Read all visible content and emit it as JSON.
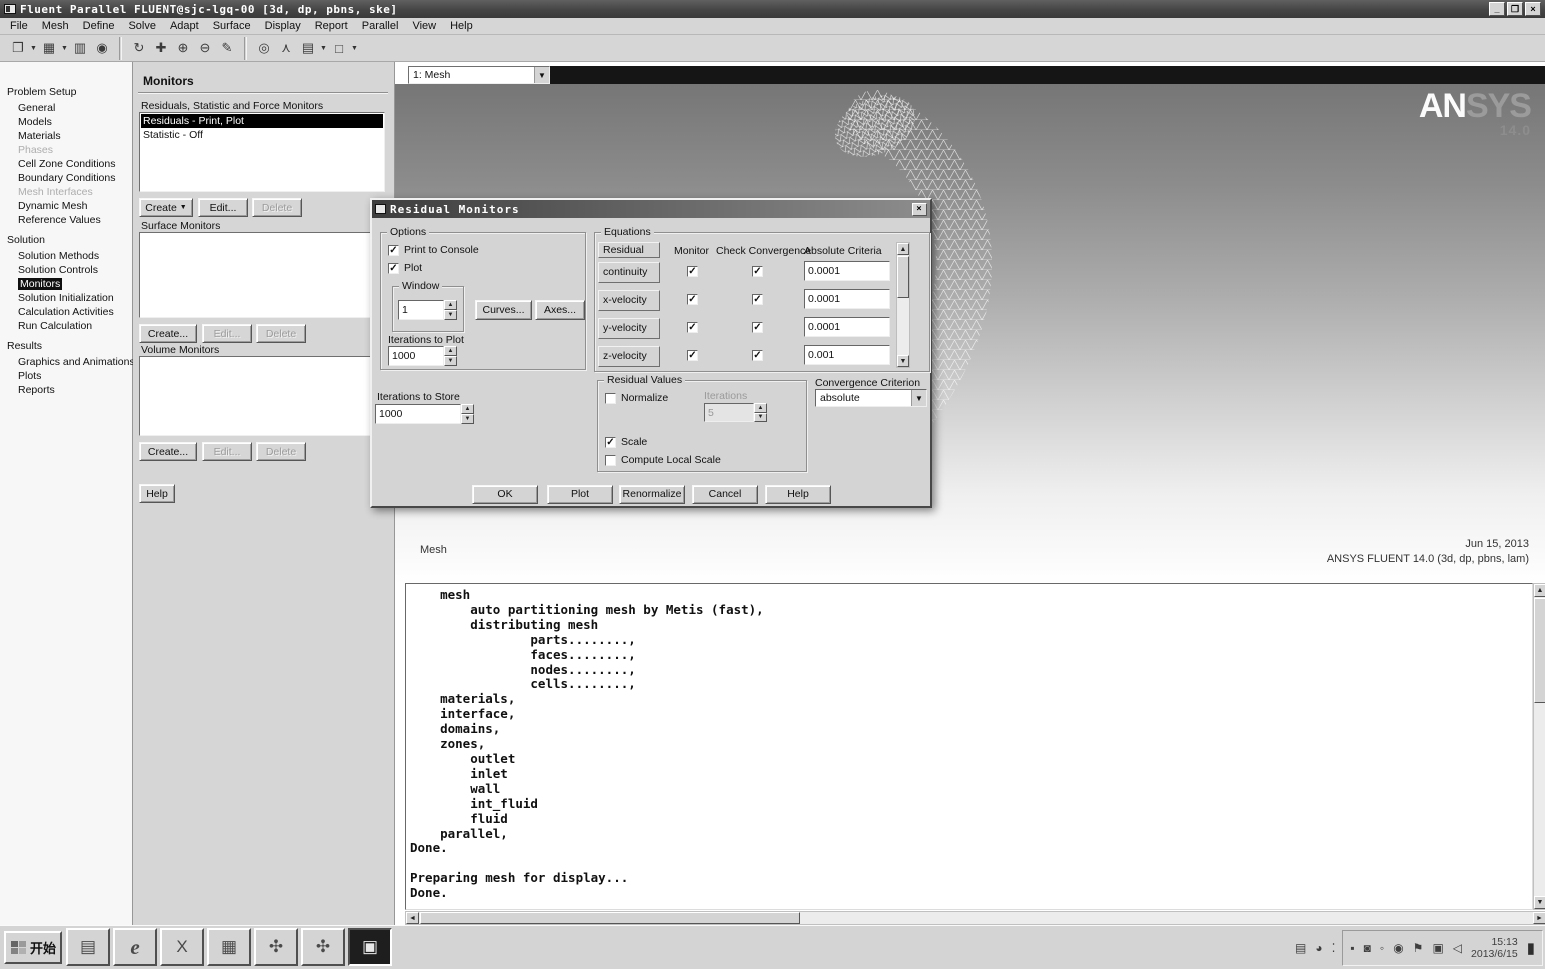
{
  "icons": {
    "dropdown": "▼",
    "up": "▲",
    "down": "▼",
    "left": "◄",
    "right": "►"
  },
  "window": {
    "title": "Fluent Parallel FLUENT@sjc-lgq-00  [3d, dp, pbns, ske]",
    "minimize": "_",
    "restore": "❐",
    "close": "×"
  },
  "menubar": {
    "items": [
      "File",
      "Mesh",
      "Define",
      "Solve",
      "Adapt",
      "Surface",
      "Display",
      "Report",
      "Parallel",
      "View",
      "Help"
    ]
  },
  "toolbar": {
    "buttons": [
      {
        "name": "open-file",
        "glyph": "❐"
      },
      {
        "name": "save-file",
        "glyph": "▦"
      },
      {
        "name": "write-file",
        "glyph": "▥"
      },
      {
        "name": "refresh",
        "glyph": "◉"
      },
      {
        "name": "rotate-view",
        "glyph": "↻"
      },
      {
        "name": "pan-view",
        "glyph": "✚"
      },
      {
        "name": "zoom-in",
        "glyph": "⊕"
      },
      {
        "name": "zoom-out",
        "glyph": "⊖"
      },
      {
        "name": "probe",
        "glyph": "✎"
      },
      {
        "name": "magnify",
        "glyph": "◎"
      },
      {
        "name": "orient",
        "glyph": "⋏"
      },
      {
        "name": "grid-display",
        "glyph": "▤"
      },
      {
        "name": "box-display",
        "glyph": "□"
      }
    ]
  },
  "sidebar": {
    "sections": [
      {
        "title": "Problem Setup",
        "items": [
          {
            "label": "General"
          },
          {
            "label": "Models"
          },
          {
            "label": "Materials"
          },
          {
            "label": "Phases",
            "state": "disabled"
          },
          {
            "label": "Cell Zone Conditions"
          },
          {
            "label": "Boundary Conditions"
          },
          {
            "label": "Mesh Interfaces",
            "state": "disabled"
          },
          {
            "label": "Dynamic Mesh"
          },
          {
            "label": "Reference Values"
          }
        ]
      },
      {
        "title": "Solution",
        "items": [
          {
            "label": "Solution Methods"
          },
          {
            "label": "Solution Controls"
          },
          {
            "label": "Monitors",
            "state": "selected"
          },
          {
            "label": "Solution Initialization"
          },
          {
            "label": "Calculation Activities"
          },
          {
            "label": "Run Calculation"
          }
        ]
      },
      {
        "title": "Results",
        "items": [
          {
            "label": "Graphics and Animations"
          },
          {
            "label": "Plots"
          },
          {
            "label": "Reports"
          }
        ]
      }
    ]
  },
  "monitors": {
    "title": "Monitors",
    "residuals_label": "Residuals, Statistic and Force Monitors",
    "residuals_list": [
      {
        "label": "Residuals - Print, Plot",
        "selected": true
      },
      {
        "label": "Statistic - Off",
        "selected": false
      }
    ],
    "residuals_buttons": {
      "create": "Create",
      "edit": "Edit...",
      "delete": "Delete"
    },
    "surface_label": "Surface Monitors",
    "surface_buttons": {
      "create": "Create...",
      "edit": "Edit...",
      "delete": "Delete"
    },
    "volume_label": "Volume Monitors",
    "volume_buttons": {
      "create": "Create...",
      "edit": "Edit...",
      "delete": "Delete"
    },
    "help": "Help"
  },
  "dialog": {
    "title": "Residual Monitors",
    "close": "×",
    "options": {
      "label": "Options",
      "print_to_console": "Print to Console",
      "print_mark": "✓",
      "plot": "Plot",
      "plot_mark": "✓",
      "window_label": "Window",
      "window_value": "1",
      "curves": "Curves...",
      "axes": "Axes...",
      "iterations_to_plot_label": "Iterations to Plot",
      "iterations_to_plot_value": "1000"
    },
    "equations": {
      "label": "Equations",
      "col_residual": "Residual",
      "col_monitor": "Monitor",
      "col_check": "Check Convergence",
      "col_criteria": "Absolute Criteria",
      "rows": [
        {
          "name": "continuity",
          "monitor_mark": "✓",
          "check_mark": "✓",
          "criteria": "0.0001"
        },
        {
          "name": "x-velocity",
          "monitor_mark": "✓",
          "check_mark": "✓",
          "criteria": "0.0001"
        },
        {
          "name": "y-velocity",
          "monitor_mark": "✓",
          "check_mark": "✓",
          "criteria": "0.0001"
        },
        {
          "name": "z-velocity",
          "monitor_mark": "✓",
          "check_mark": "✓",
          "criteria": "0.001"
        }
      ]
    },
    "iterations_to_store": {
      "label": "Iterations to Store",
      "value": "1000"
    },
    "residual_values": {
      "label": "Residual Values",
      "normalize": "Normalize",
      "normalize_mark": "",
      "iterations_label": "Iterations",
      "iterations_value": "5",
      "scale": "Scale",
      "scale_mark": "✓",
      "compute_local_scale": "Compute Local Scale",
      "compute_mark": ""
    },
    "convergence": {
      "label": "Convergence Criterion",
      "value": "absolute"
    },
    "buttons": [
      "OK",
      "Plot",
      "Renormalize",
      "Cancel",
      "Help"
    ]
  },
  "graphics": {
    "view_selector": "1: Mesh",
    "logo_an": "AN",
    "logo_sys": "SYS",
    "logo_version": "14.0",
    "caption": "Mesh",
    "date": "Jun 15, 2013",
    "version_line": "ANSYS FLUENT 14.0 (3d, dp, pbns, lam)",
    "console_text": "    mesh\n        auto partitioning mesh by Metis (fast),\n        distributing mesh\n                parts........,\n                faces........,\n                nodes........,\n                cells........,\n    materials,\n    interface,\n    domains,\n    zones,\n        outlet\n        inlet\n        wall\n        int_fluid\n        fluid\n    parallel,\nDone.\n\nPreparing mesh for display...\nDone."
  },
  "taskbar": {
    "start": "开始",
    "quicklaunch": [
      {
        "name": "show-desktop",
        "glyph": "▤"
      },
      {
        "name": "internet-explorer",
        "glyph": "e"
      },
      {
        "name": "excel",
        "glyph": "X"
      },
      {
        "name": "document-viewer",
        "glyph": "▦"
      },
      {
        "name": "cad-app-1",
        "glyph": "✣"
      },
      {
        "name": "cad-app-2",
        "glyph": "✣"
      },
      {
        "name": "fluent-window",
        "glyph": "▣"
      }
    ],
    "pre_tray": [
      {
        "name": "folder",
        "glyph": "▤"
      },
      {
        "name": "power",
        "glyph": "◕"
      },
      {
        "name": "dots",
        "glyph": "⁚"
      }
    ],
    "tray": [
      {
        "name": "updates",
        "glyph": "▪"
      },
      {
        "name": "security-lock",
        "glyph": "◙"
      },
      {
        "name": "volume-mixer",
        "glyph": "◦"
      },
      {
        "name": "language",
        "glyph": "◉"
      },
      {
        "name": "flag",
        "glyph": "⚑"
      },
      {
        "name": "display",
        "glyph": "▣"
      },
      {
        "name": "speaker",
        "glyph": "◁"
      }
    ],
    "clock_time": "15:13",
    "clock_date": "2013/6/15",
    "network_glyph": "▮"
  }
}
